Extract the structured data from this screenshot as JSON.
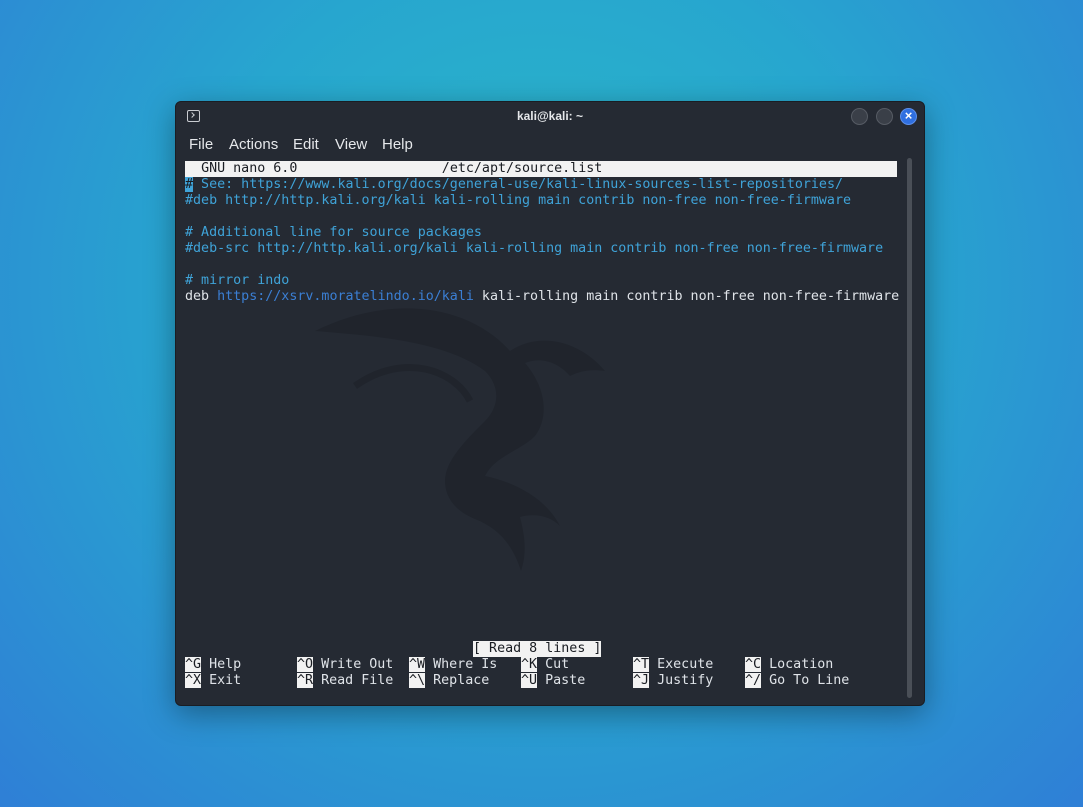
{
  "window": {
    "title": "kali@kali: ~"
  },
  "menu": {
    "file": "File",
    "actions": "Actions",
    "edit": "Edit",
    "view": "View",
    "help": "Help"
  },
  "nano": {
    "version": "GNU nano 6.0",
    "filename": "/etc/apt/source.list",
    "line1_cursor": "#",
    "line1_rest": " See: https://www.kali.org/docs/general-use/kali-linux-sources-list-repositories/",
    "line2": "#deb http://http.kali.org/kali kali-rolling main contrib non-free non-free-firmware",
    "line4": "# Additional line for source packages",
    "line5": "#deb-src http://http.kali.org/kali kali-rolling main contrib non-free non-free-firmware",
    "line7": "# mirror indo",
    "line8_deb": "deb ",
    "line8_url": "https://xsrv.moratelindo.io/kali",
    "line8_rest": " kali-rolling main contrib non-free non-free-firmware",
    "status": "[ Read 8 lines ]"
  },
  "shortcuts": [
    {
      "key": "^G",
      "label": "Help"
    },
    {
      "key": "^O",
      "label": "Write Out"
    },
    {
      "key": "^W",
      "label": "Where Is"
    },
    {
      "key": "^K",
      "label": "Cut"
    },
    {
      "key": "^T",
      "label": "Execute"
    },
    {
      "key": "^C",
      "label": "Location"
    },
    {
      "key": "^X",
      "label": "Exit"
    },
    {
      "key": "^R",
      "label": "Read File"
    },
    {
      "key": "^\\",
      "label": "Replace"
    },
    {
      "key": "^U",
      "label": "Paste"
    },
    {
      "key": "^J",
      "label": "Justify"
    },
    {
      "key": "^/",
      "label": "Go To Line"
    }
  ]
}
